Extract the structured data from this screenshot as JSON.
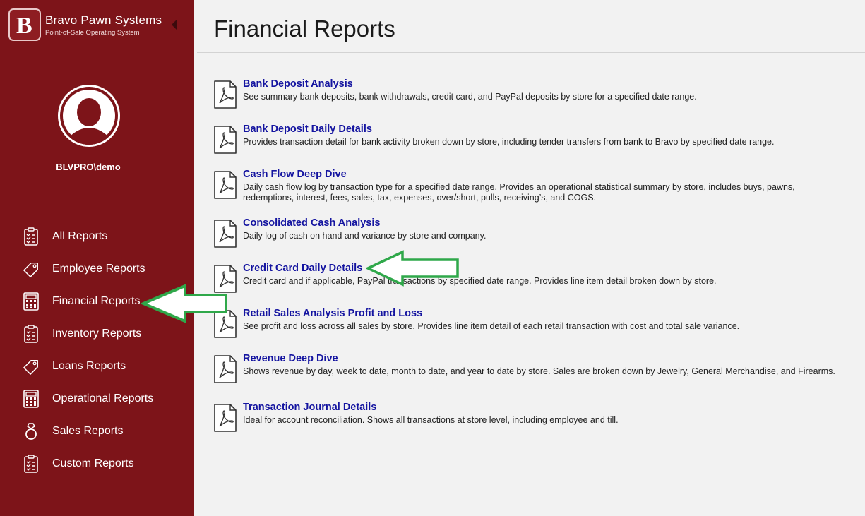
{
  "brand": {
    "name": "Bravo Pawn Systems",
    "subtitle": "Point-of-Sale Operating System",
    "logo_letter": "B"
  },
  "user": {
    "name": "BLVPRO\\demo"
  },
  "nav": {
    "items": [
      {
        "label": "All Reports",
        "icon": "clipboard-list-icon"
      },
      {
        "label": "Employee Reports",
        "icon": "tag-icon"
      },
      {
        "label": "Financial Reports",
        "icon": "calculator-icon"
      },
      {
        "label": "Inventory Reports",
        "icon": "clipboard-list-icon"
      },
      {
        "label": "Loans Reports",
        "icon": "tag-icon"
      },
      {
        "label": "Operational Reports",
        "icon": "calculator-icon"
      },
      {
        "label": "Sales Reports",
        "icon": "ring-icon"
      },
      {
        "label": "Custom Reports",
        "icon": "clipboard-list-icon"
      }
    ]
  },
  "page": {
    "title": "Financial Reports"
  },
  "reports": [
    {
      "title": "Bank Deposit Analysis",
      "description": "See summary bank deposits, bank withdrawals, credit card, and PayPal deposits by store for a specified date range."
    },
    {
      "title": "Bank Deposit Daily Details",
      "description": "Provides transaction detail for bank activity broken down by store, including tender transfers from bank to Bravo by specified date range."
    },
    {
      "title": "Cash Flow Deep Dive",
      "description": "Daily cash flow log by transaction type for a specified date range. Provides an operational statistical summary by store, includes buys, pawns, redemptions, interest, fees, sales, tax, expenses, over/short, pulls, receiving’s, and COGS."
    },
    {
      "title": "Consolidated Cash Analysis",
      "description": "Daily log of cash on hand and variance by store and company."
    },
    {
      "title": "Credit Card Daily Details",
      "description": "Credit card and if applicable, PayPal transactions by specified date range. Provides line item detail broken down by store."
    },
    {
      "title": "Retail Sales Analysis Profit and Loss",
      "description": "See profit and loss across all sales by store. Provides line item detail of each retail transaction with cost and total sale variance."
    },
    {
      "title": "Revenue Deep Dive",
      "description": "Shows revenue by day, week to date, month to date, and year to date by store. Sales are broken down by Jewelry, General Merchandise, and Firearms."
    },
    {
      "title": "Transaction Journal Details",
      "description": "Ideal for account reconciliation. Shows all transactions at store level, including employee and till."
    }
  ],
  "colors": {
    "sidebar_bg": "#7d1419",
    "link": "#1414a0",
    "annotation_arrow": "#2fa84a"
  }
}
